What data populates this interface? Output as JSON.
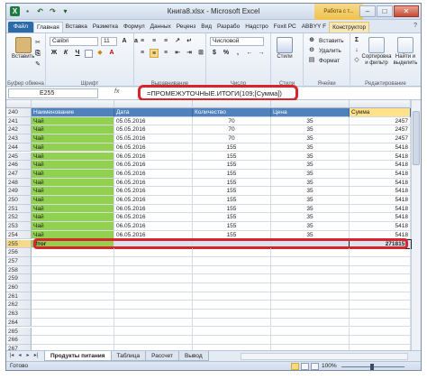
{
  "window": {
    "title": "Книга8.xlsx - Microsoft Excel",
    "table_tools": "Работа с т...",
    "buttons": [
      "–",
      "□",
      "✕"
    ]
  },
  "ribbon_tabs": [
    "Файл",
    "Главная",
    "Вставка",
    "Разметка",
    "Формул",
    "Данных",
    "Реценз",
    "Вид",
    "Разрабо",
    "Надстро",
    "Foxit PC",
    "ABBYY F",
    "Конструктор"
  ],
  "ribbon": {
    "clipboard": {
      "paste": "Вставить",
      "label": "Буфер обмена"
    },
    "font": {
      "name": "Calibri",
      "size": "11",
      "label": "Шрифт"
    },
    "alignment": {
      "label": "Выравнивание"
    },
    "number": {
      "format": "Числовой",
      "label": "Число"
    },
    "styles": {
      "label": "Стили",
      "button": "Стили"
    },
    "cells": {
      "insert": "Вставить",
      "delete": "Удалить",
      "format": "Формат",
      "label": "Ячейки"
    },
    "editing": {
      "sort": "Сортировка и фильтр",
      "find": "Найти и выделить",
      "label": "Редактирование"
    }
  },
  "formula_bar": {
    "name_box": "E255",
    "fx": "fx",
    "formula": "=ПРОМЕЖУТОЧНЫЕ.ИТОГИ(109;[Сумма])"
  },
  "table": {
    "headers": [
      "Наименование",
      "Дата",
      "Количество",
      "Цена",
      "Сумма"
    ],
    "rows": [
      {
        "num": "241",
        "name": "Чай",
        "date": "05.05.2016",
        "qty": "70",
        "price": "35",
        "sum": "2457"
      },
      {
        "num": "242",
        "name": "Чай",
        "date": "05.05.2016",
        "qty": "70",
        "price": "35",
        "sum": "2457"
      },
      {
        "num": "243",
        "name": "Чай",
        "date": "05.05.2016",
        "qty": "70",
        "price": "35",
        "sum": "2457"
      },
      {
        "num": "244",
        "name": "Чай",
        "date": "06.05.2016",
        "qty": "155",
        "price": "35",
        "sum": "5418"
      },
      {
        "num": "245",
        "name": "Чай",
        "date": "06.05.2016",
        "qty": "155",
        "price": "35",
        "sum": "5418"
      },
      {
        "num": "246",
        "name": "Чай",
        "date": "06.05.2016",
        "qty": "155",
        "price": "35",
        "sum": "5418"
      },
      {
        "num": "247",
        "name": "Чай",
        "date": "06.05.2016",
        "qty": "155",
        "price": "35",
        "sum": "5418"
      },
      {
        "num": "248",
        "name": "Чай",
        "date": "06.05.2016",
        "qty": "155",
        "price": "35",
        "sum": "5418"
      },
      {
        "num": "249",
        "name": "Чай",
        "date": "06.05.2016",
        "qty": "155",
        "price": "35",
        "sum": "5418"
      },
      {
        "num": "250",
        "name": "Чай",
        "date": "06.05.2016",
        "qty": "155",
        "price": "35",
        "sum": "5418"
      },
      {
        "num": "251",
        "name": "Чай",
        "date": "06.05.2016",
        "qty": "155",
        "price": "35",
        "sum": "5418"
      },
      {
        "num": "252",
        "name": "Чай",
        "date": "06.05.2016",
        "qty": "155",
        "price": "35",
        "sum": "5418"
      },
      {
        "num": "253",
        "name": "Чай",
        "date": "06.05.2016",
        "qty": "155",
        "price": "35",
        "sum": "5418"
      },
      {
        "num": "254",
        "name": "Чай",
        "date": "06.05.2016",
        "qty": "155",
        "price": "35",
        "sum": "5418"
      }
    ],
    "header_row_num": "240",
    "total": {
      "num": "255",
      "label": "Итог",
      "sum": "2718157"
    },
    "empty_rows": [
      "256",
      "257",
      "258",
      "259",
      "260",
      "261",
      "262",
      "263",
      "264",
      "265",
      "266",
      "267"
    ]
  },
  "sheet_tabs": [
    "Продукты питания",
    "Таблица",
    "Рассчет",
    "Вывод"
  ],
  "status": {
    "ready": "Готово",
    "zoom": "100%"
  },
  "colors": {
    "header_blue": "#4f81bd",
    "green_fill": "#92d050",
    "highlight_red": "#d8252c"
  }
}
